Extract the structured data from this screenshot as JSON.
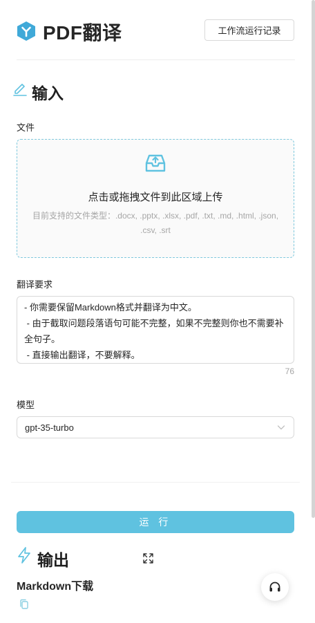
{
  "header": {
    "app_title": "PDF翻译",
    "history_button": "工作流运行记录"
  },
  "input_section": {
    "title": "输入",
    "file": {
      "label": "文件",
      "upload_text": "点击或拖拽文件到此区域上传",
      "upload_hint": "目前支持的文件类型：.docx, .pptx, .xlsx, .pdf, .txt, .md, .html, .json, .csv, .srt"
    },
    "requirements": {
      "label": "翻译要求",
      "value": "- 你需要保留Markdown格式并翻译为中文。\n - 由于截取问题段落语句可能不完整，如果不完整则你也不需要补全句子。\n - 直接输出翻译，不要解释。",
      "count": "76"
    },
    "model": {
      "label": "模型",
      "selected": "gpt-35-turbo"
    },
    "run_button": "运 行"
  },
  "output_section": {
    "title": "输出",
    "markdown_download_label": "Markdown下载"
  },
  "colors": {
    "accent": "#5fc2e0",
    "logo": "#40a9d8"
  }
}
